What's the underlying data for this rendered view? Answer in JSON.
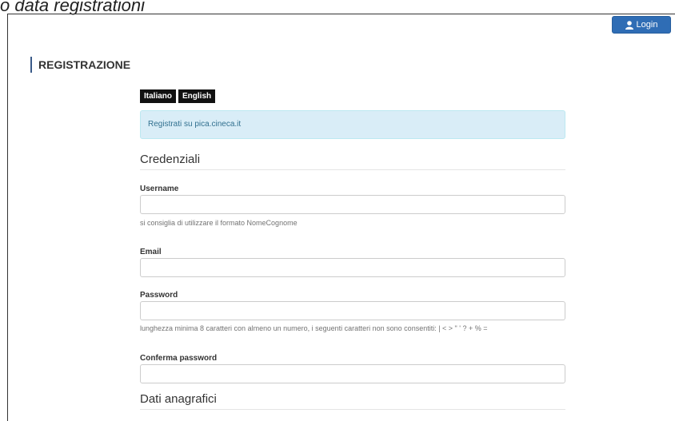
{
  "caption": "o data registrationi",
  "header": {
    "login_label": "Login"
  },
  "page": {
    "section_title": "REGISTRAZIONE",
    "languages": [
      "Italiano",
      "English"
    ],
    "info": "Registrati su pica.cineca.it"
  },
  "credentials": {
    "title": "Credenziali",
    "username": {
      "label": "Username",
      "value": "",
      "help": "si consiglia di utilizzare il formato NomeCognome"
    },
    "email": {
      "label": "Email",
      "value": ""
    },
    "password": {
      "label": "Password",
      "value": "",
      "help": "lunghezza minima 8 caratteri con almeno un numero, i seguenti caratteri non sono consentiti: | < > \" ' ? + % ="
    },
    "confirm_password": {
      "label": "Conferma password",
      "value": ""
    }
  },
  "personal": {
    "title": "Dati anagrafici"
  },
  "colors": {
    "accent": "#2f6db5",
    "info_bg": "#d9edf7",
    "info_text": "#31708f"
  }
}
